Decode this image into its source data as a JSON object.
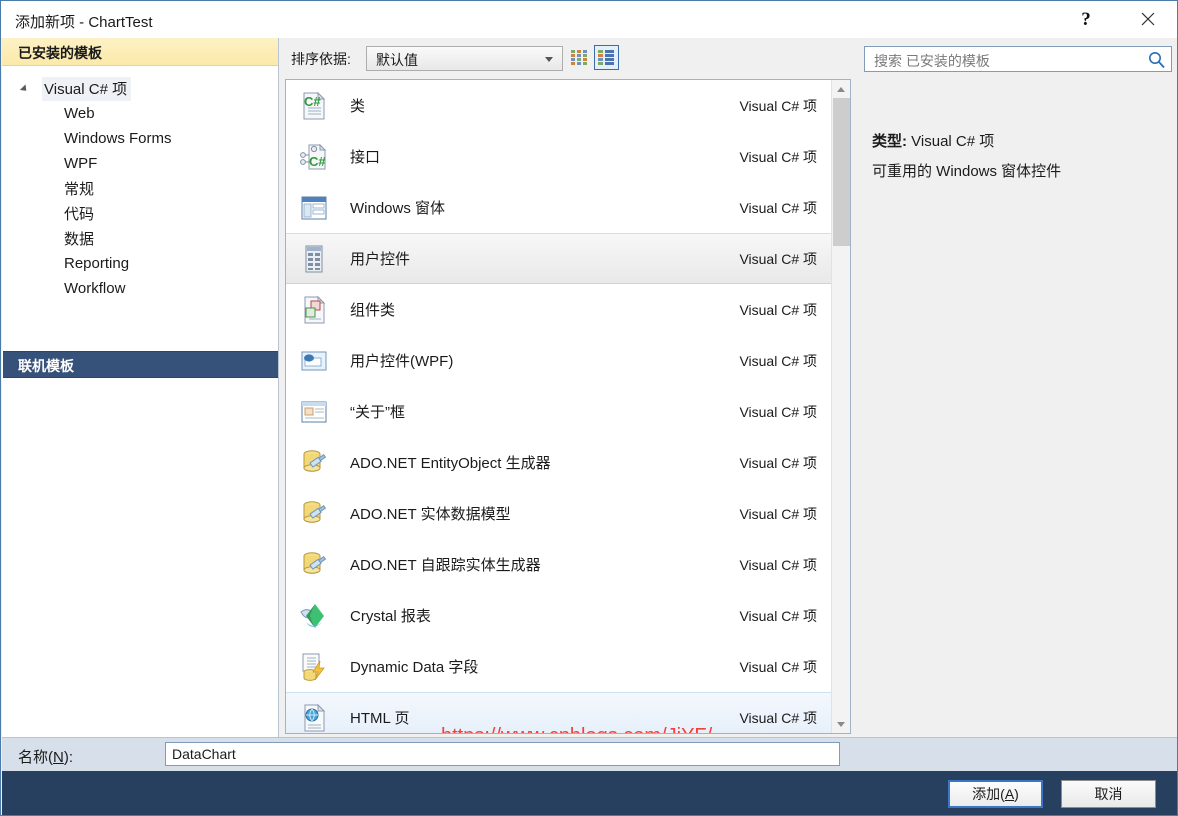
{
  "window": {
    "title": "添加新项 - ChartTest",
    "help_glyph": "?",
    "close_glyph": "✕"
  },
  "sidebar": {
    "installed_header": "已安装的模板",
    "root": {
      "label": "Visual C# 项"
    },
    "children": [
      {
        "label": "Web"
      },
      {
        "label": "Windows Forms"
      },
      {
        "label": "WPF"
      },
      {
        "label": "常规"
      },
      {
        "label": "代码"
      },
      {
        "label": "数据"
      },
      {
        "label": "Reporting"
      },
      {
        "label": "Workflow"
      }
    ],
    "online_header": "联机模板"
  },
  "sortbar": {
    "label": "排序依据:",
    "selected": "默认值",
    "options": [
      "默认值"
    ],
    "view_small_name": "small-icons-view",
    "view_large_name": "medium-icons-view"
  },
  "list": {
    "items": [
      {
        "name": "类",
        "kind": "Visual C# 项",
        "icon": "csharp-class-icon",
        "state": "normal"
      },
      {
        "name": "接口",
        "kind": "Visual C# 项",
        "icon": "csharp-interface-icon",
        "state": "normal"
      },
      {
        "name": "Windows 窗体",
        "kind": "Visual C# 项",
        "icon": "windows-form-icon",
        "state": "normal"
      },
      {
        "name": "用户控件",
        "kind": "Visual C# 项",
        "icon": "user-control-icon",
        "state": "selected"
      },
      {
        "name": "组件类",
        "kind": "Visual C# 项",
        "icon": "component-class-icon",
        "state": "normal"
      },
      {
        "name": "用户控件(WPF)",
        "kind": "Visual C# 项",
        "icon": "wpf-user-control-icon",
        "state": "normal"
      },
      {
        "name": "“关于”框",
        "kind": "Visual C# 项",
        "icon": "about-box-icon",
        "state": "normal"
      },
      {
        "name": "ADO.NET EntityObject 生成器",
        "kind": "Visual C# 项",
        "icon": "ado-entity-generator-icon",
        "state": "normal"
      },
      {
        "name": "ADO.NET 实体数据模型",
        "kind": "Visual C# 项",
        "icon": "ado-entity-model-icon",
        "state": "normal"
      },
      {
        "name": "ADO.NET 自跟踪实体生成器",
        "kind": "Visual C# 项",
        "icon": "ado-selftracking-icon",
        "state": "normal"
      },
      {
        "name": "Crystal 报表",
        "kind": "Visual C# 项",
        "icon": "crystal-report-icon",
        "state": "normal"
      },
      {
        "name": "Dynamic Data 字段",
        "kind": "Visual C# 项",
        "icon": "dynamic-data-field-icon",
        "state": "normal"
      },
      {
        "name": "HTML 页",
        "kind": "Visual C# 项",
        "icon": "html-page-icon",
        "state": "hovered"
      }
    ]
  },
  "watermark": {
    "text": "https://www.cnblogs.com/JiYF/",
    "color": "#f2403c"
  },
  "search": {
    "placeholder": "搜索 已安装的模板",
    "value": ""
  },
  "details": {
    "type_label": "类型:",
    "type_value": "Visual C# 项",
    "description": "可重用的 Windows 窗体控件"
  },
  "name_field": {
    "label_prefix": "名称(",
    "label_accel": "N",
    "label_suffix": "):",
    "value": "DataChart"
  },
  "footer": {
    "add_prefix": "添加(",
    "add_accel": "A",
    "add_suffix": ")",
    "cancel_label": "取消"
  }
}
